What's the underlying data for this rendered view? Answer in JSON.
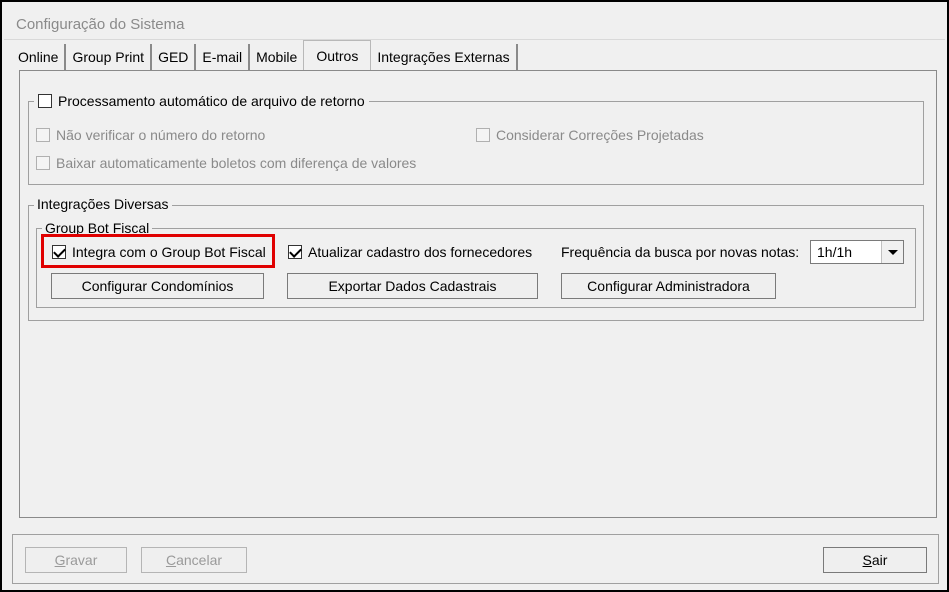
{
  "window": {
    "title": "Configuração do Sistema"
  },
  "tabs": [
    {
      "label": "Online"
    },
    {
      "label": "Group Print"
    },
    {
      "label": "GED"
    },
    {
      "label": "E-mail"
    },
    {
      "label": "Mobile"
    },
    {
      "label": "Outros",
      "active": true
    },
    {
      "label": "Integrações Externas"
    }
  ],
  "retorno": {
    "legend": "Processamento automático de arquivo de retorno",
    "checked": false,
    "options": [
      {
        "label": "Não verificar o número do retorno",
        "enabled": false,
        "checked": false
      },
      {
        "label": "Considerar Correções Projetadas",
        "enabled": false,
        "checked": false
      },
      {
        "label": "Baixar automaticamente boletos com diferença de valores",
        "enabled": false,
        "checked": false
      }
    ]
  },
  "integracoes": {
    "legend": "Integrações Diversas",
    "bot_fiscal": {
      "legend": "Group Bot Fiscal",
      "integra": {
        "label": "Integra com o Group Bot Fiscal",
        "checked": true
      },
      "atualizar": {
        "label": "Atualizar cadastro dos fornecedores",
        "checked": true
      },
      "frequencia_label": "Frequência da busca por novas notas:",
      "frequencia_value": "1h/1h",
      "buttons": {
        "condominios": "Configurar Condomínios",
        "exportar": "Exportar Dados Cadastrais",
        "administradora": "Configurar Administradora"
      }
    }
  },
  "footer": {
    "gravar_pre": "",
    "gravar_u": "G",
    "gravar_post": "ravar",
    "cancelar_pre": "",
    "cancelar_u": "C",
    "cancelar_post": "ancelar",
    "sair_pre": "",
    "sair_u": "S",
    "sair_post": "air"
  },
  "colors": {
    "highlight": "#e00000",
    "disabled_text": "#8a8a8a"
  }
}
